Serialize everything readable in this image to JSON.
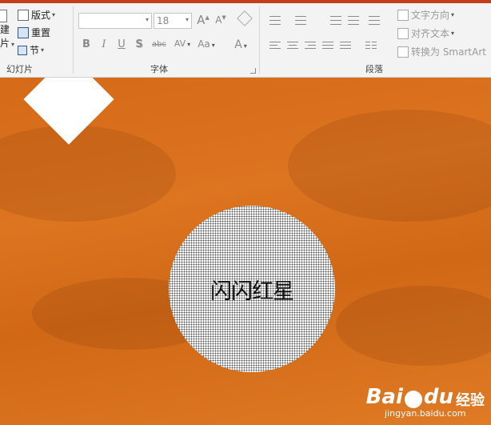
{
  "slides_group": {
    "label": "幻灯片",
    "new_slide_fragment_top": "建",
    "new_slide_fragment_bottom": "片",
    "layout": "版式",
    "reset": "重置",
    "section": "节"
  },
  "font_group": {
    "label": "字体",
    "font_name": "",
    "font_size": "18",
    "bold": "B",
    "italic": "I",
    "underline": "U",
    "shadow": "S",
    "strike": "abc",
    "spacing": "AV",
    "case": "Aa",
    "grow": "A",
    "shrink": "A",
    "color": "A"
  },
  "paragraph_group": {
    "label": "段落",
    "text_direction": "文字方向",
    "align_text": "对齐文本",
    "convert_smartart": "转换为 SmartArt"
  },
  "slide": {
    "circle_text": "闪闪红星",
    "diamond_color": "#ffffff",
    "background_color": "#d9701c"
  },
  "watermark": {
    "brand": "Bai",
    "brand2": "du",
    "jingyan": "经验",
    "url": "jingyan.baidu.com"
  }
}
